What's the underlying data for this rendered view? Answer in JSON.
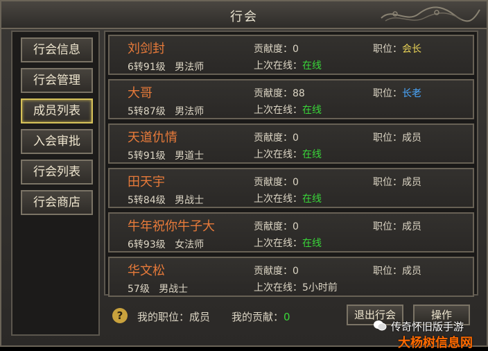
{
  "window": {
    "title": "行会"
  },
  "sidebar": {
    "items": [
      {
        "label": "行会信息",
        "active": false
      },
      {
        "label": "行会管理",
        "active": false
      },
      {
        "label": "成员列表",
        "active": true
      },
      {
        "label": "入会审批",
        "active": false
      },
      {
        "label": "行会列表",
        "active": false
      },
      {
        "label": "行会商店",
        "active": false
      }
    ]
  },
  "labels": {
    "contribution": "贡献度：",
    "last_online": "上次在线：",
    "position": "职位："
  },
  "members": [
    {
      "name": "刘剑封",
      "level": "6转91级",
      "class": "男法师",
      "contribution": "0",
      "last_online": "在线",
      "position": "会长"
    },
    {
      "name": "大哥",
      "level": "5转87级",
      "class": "男法师",
      "contribution": "88",
      "last_online": "在线",
      "position": "长老"
    },
    {
      "name": "天道仇情",
      "level": "5转91级",
      "class": "男道士",
      "contribution": "0",
      "last_online": "在线",
      "position": "成员"
    },
    {
      "name": "田天宇",
      "level": "5转84级",
      "class": "男战士",
      "contribution": "0",
      "last_online": "在线",
      "position": "成员"
    },
    {
      "name": "牛年祝你牛子大",
      "level": "6转93级",
      "class": "女法师",
      "contribution": "0",
      "last_online": "在线",
      "position": "成员"
    },
    {
      "name": "华文松",
      "level": "57级",
      "class": "男战士",
      "contribution": "0",
      "last_online": "5小时前",
      "position": "成员"
    }
  ],
  "footer": {
    "my_position_label": "我的职位：",
    "my_position": "成员",
    "my_contribution_label": "我的贡献：",
    "my_contribution": "0",
    "leave_button": "退出行会",
    "action_button": "操作"
  },
  "watermark": {
    "line1": "传奇怀旧版手游",
    "line2": "大杨树信息网"
  },
  "colors": {
    "name": "#e77a3a",
    "online": "#39d739",
    "leader": "#e8d256",
    "elder": "#4aa8ff"
  }
}
